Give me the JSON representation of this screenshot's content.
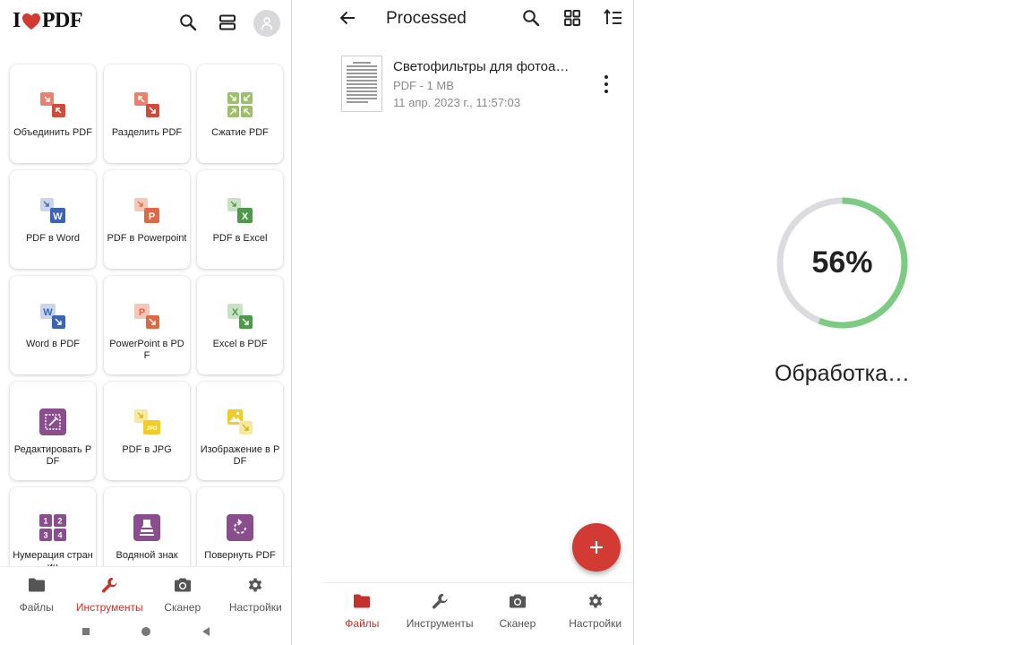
{
  "colors": {
    "brand_red": "#d23b33",
    "active_red": "#c4322c",
    "progress_green": "#7ccb82",
    "progress_track": "#dcdce0"
  },
  "tools_screen": {
    "logo": {
      "left": "I",
      "right": "PDF",
      "heart": "heart-icon"
    },
    "header_icons": [
      "search-icon",
      "layout-toggle-icon",
      "avatar-icon"
    ],
    "tools": [
      {
        "label": "Объединить PDF",
        "icon": "merge-icon"
      },
      {
        "label": "Разделить PDF",
        "icon": "split-icon"
      },
      {
        "label": "Сжатие PDF",
        "icon": "compress-icon"
      },
      {
        "label": "PDF в Word",
        "icon": "pdf-to-word-icon"
      },
      {
        "label": "PDF в Powerpoint",
        "icon": "pdf-to-powerpoint-icon"
      },
      {
        "label": "PDF в Excel",
        "icon": "pdf-to-excel-icon"
      },
      {
        "label": "Word в PDF",
        "icon": "word-to-pdf-icon"
      },
      {
        "label": "PowerPoint в PDF",
        "icon": "powerpoint-to-pdf-icon"
      },
      {
        "label": "Excel в PDF",
        "icon": "excel-to-pdf-icon"
      },
      {
        "label": "Редактировать PDF",
        "icon": "edit-pdf-icon"
      },
      {
        "label": "PDF в JPG",
        "icon": "pdf-to-jpg-icon"
      },
      {
        "label": "Изображение в PDF",
        "icon": "image-to-pdf-icon"
      },
      {
        "label": "Нумерация страниц",
        "icon": "page-numbers-icon"
      },
      {
        "label": "Водяной знак",
        "icon": "watermark-icon"
      },
      {
        "label": "Повернуть PDF",
        "icon": "rotate-pdf-icon"
      }
    ],
    "bottom_nav": [
      {
        "label": "Файлы",
        "icon": "folder-icon",
        "active": false
      },
      {
        "label": "Инструменты",
        "icon": "wrench-icon",
        "active": true
      },
      {
        "label": "Сканер",
        "icon": "camera-icon",
        "active": false
      },
      {
        "label": "Настройки",
        "icon": "gear-icon",
        "active": false
      }
    ],
    "system_nav": [
      "recents-square-icon",
      "home-circle-icon",
      "back-triangle-icon"
    ]
  },
  "files_screen": {
    "title": "Processed",
    "header_icons": [
      "back-arrow-icon",
      "search-icon",
      "grid-view-icon",
      "sort-icon"
    ],
    "file": {
      "name": "Светофильтры для фотоа…",
      "type_size": "PDF - 1 MB",
      "date": "11 апр. 2023 г., 11:57:03"
    },
    "fab_icon": "plus-icon",
    "bottom_nav": [
      {
        "label": "Файлы",
        "icon": "folder-icon",
        "active": true
      },
      {
        "label": "Инструменты",
        "icon": "wrench-icon",
        "active": false
      },
      {
        "label": "Сканер",
        "icon": "camera-icon",
        "active": false
      },
      {
        "label": "Настройки",
        "icon": "gear-icon",
        "active": false
      }
    ]
  },
  "processing_screen": {
    "progress": 0.56,
    "percent_label": "56%",
    "status": "Обработка…"
  }
}
